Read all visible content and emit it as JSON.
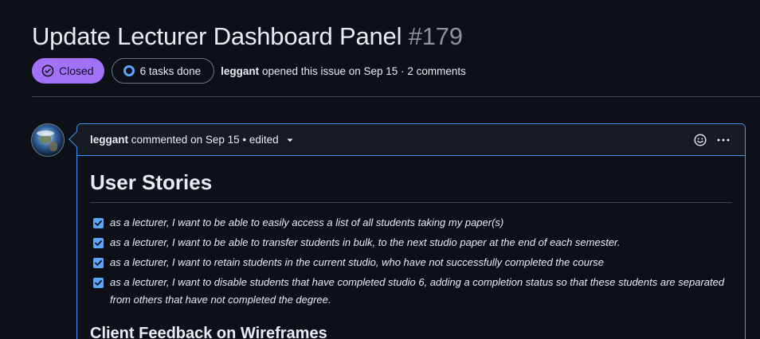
{
  "issue": {
    "title": "Update Lecturer Dashboard Panel",
    "number": "#179",
    "state_label": "Closed",
    "tasks_label": "6 tasks done",
    "author": "leggant",
    "opened_text": "opened this issue on Sep 15 · 2 comments"
  },
  "comment": {
    "author": "leggant",
    "meta": "commented on Sep 15 • edited",
    "heading": "User Stories",
    "tasks": [
      {
        "checked": true,
        "text": "as a lecturer, I want to be able to easily access a list of all students taking my paper(s)"
      },
      {
        "checked": true,
        "text": "as a lecturer, I want to be able to transfer students in bulk, to the next studio paper at the end of each semester."
      },
      {
        "checked": true,
        "text": "as a lecturer, I want to retain students in the current studio, who have not successfully completed the course"
      },
      {
        "checked": true,
        "text": "as a lecturer, I want to disable students that have completed studio 6, adding a completion status so that these students are separated from others that have not completed the degree."
      }
    ],
    "next_heading": "Client Feedback on Wireframes"
  },
  "icons": {
    "state": "issue-closed-icon",
    "tasks": "progress-circle-icon",
    "header_caret": "triangle-down-icon",
    "reaction": "smiley-icon",
    "menu": "kebab-horizontal-icon",
    "task_check": "checkbox-checked-icon"
  },
  "colors": {
    "background": "#0d1117",
    "closed_badge": "#a371f7",
    "focus_border": "#4493f8",
    "checkbox": "#58a6ff",
    "muted_text": "#8b949e"
  }
}
